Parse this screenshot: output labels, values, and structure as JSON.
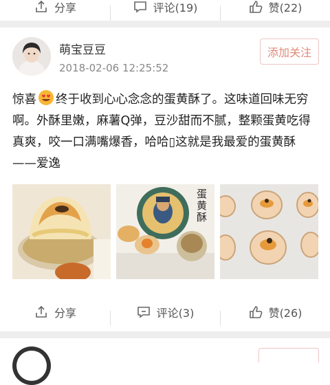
{
  "prev_actions": {
    "share_label": "分享",
    "comment_label": "评论(19)",
    "like_label": "赞(22)"
  },
  "post": {
    "username": "萌宝豆豆",
    "timestamp": "2018-02-06 12:25:52",
    "follow_label": "添加关注",
    "text_part1": "惊喜",
    "text_part2": "终于收到心心念念的蛋黄酥了。这味道回味无穷啊。外酥里嫩，麻薯Q弹，豆沙甜而不腻，整颗蛋黄吃得真爽，咬一口满嘴爆香，哈哈▯这就是我最爱的蛋黄酥——爱逸",
    "images": [
      {
        "icon": "pastry-photo"
      },
      {
        "icon": "packaging-photo"
      },
      {
        "icon": "tray-photo"
      }
    ],
    "thumb2_text": "蛋黄酥"
  },
  "actions": {
    "share_label": "分享",
    "comment_label": "评论(3)",
    "like_label": "赞(26)"
  },
  "colors": {
    "accent": "#e08a7a",
    "divider": "#eeeeee",
    "text": "#333333",
    "muted": "#888888"
  }
}
